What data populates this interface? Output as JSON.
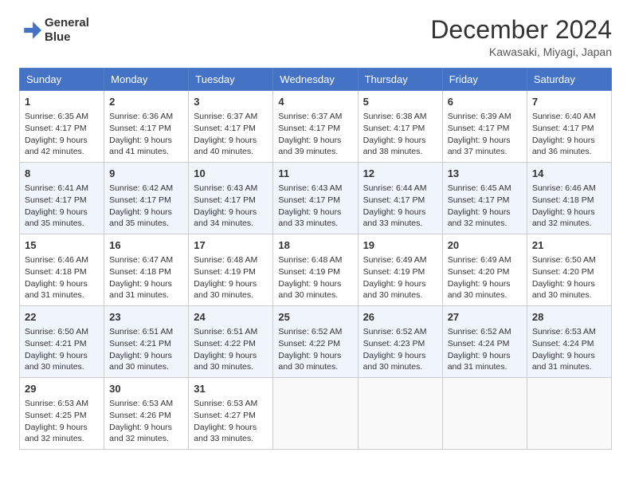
{
  "logo": {
    "line1": "General",
    "line2": "Blue"
  },
  "title": "December 2024",
  "subtitle": "Kawasaki, Miyagi, Japan",
  "headers": [
    "Sunday",
    "Monday",
    "Tuesday",
    "Wednesday",
    "Thursday",
    "Friday",
    "Saturday"
  ],
  "weeks": [
    [
      {
        "day": "1",
        "sunrise": "6:35 AM",
        "sunset": "4:17 PM",
        "daylight": "9 hours and 42 minutes."
      },
      {
        "day": "2",
        "sunrise": "6:36 AM",
        "sunset": "4:17 PM",
        "daylight": "9 hours and 41 minutes."
      },
      {
        "day": "3",
        "sunrise": "6:37 AM",
        "sunset": "4:17 PM",
        "daylight": "9 hours and 40 minutes."
      },
      {
        "day": "4",
        "sunrise": "6:37 AM",
        "sunset": "4:17 PM",
        "daylight": "9 hours and 39 minutes."
      },
      {
        "day": "5",
        "sunrise": "6:38 AM",
        "sunset": "4:17 PM",
        "daylight": "9 hours and 38 minutes."
      },
      {
        "day": "6",
        "sunrise": "6:39 AM",
        "sunset": "4:17 PM",
        "daylight": "9 hours and 37 minutes."
      },
      {
        "day": "7",
        "sunrise": "6:40 AM",
        "sunset": "4:17 PM",
        "daylight": "9 hours and 36 minutes."
      }
    ],
    [
      {
        "day": "8",
        "sunrise": "6:41 AM",
        "sunset": "4:17 PM",
        "daylight": "9 hours and 35 minutes."
      },
      {
        "day": "9",
        "sunrise": "6:42 AM",
        "sunset": "4:17 PM",
        "daylight": "9 hours and 35 minutes."
      },
      {
        "day": "10",
        "sunrise": "6:43 AM",
        "sunset": "4:17 PM",
        "daylight": "9 hours and 34 minutes."
      },
      {
        "day": "11",
        "sunrise": "6:43 AM",
        "sunset": "4:17 PM",
        "daylight": "9 hours and 33 minutes."
      },
      {
        "day": "12",
        "sunrise": "6:44 AM",
        "sunset": "4:17 PM",
        "daylight": "9 hours and 33 minutes."
      },
      {
        "day": "13",
        "sunrise": "6:45 AM",
        "sunset": "4:17 PM",
        "daylight": "9 hours and 32 minutes."
      },
      {
        "day": "14",
        "sunrise": "6:46 AM",
        "sunset": "4:18 PM",
        "daylight": "9 hours and 32 minutes."
      }
    ],
    [
      {
        "day": "15",
        "sunrise": "6:46 AM",
        "sunset": "4:18 PM",
        "daylight": "9 hours and 31 minutes."
      },
      {
        "day": "16",
        "sunrise": "6:47 AM",
        "sunset": "4:18 PM",
        "daylight": "9 hours and 31 minutes."
      },
      {
        "day": "17",
        "sunrise": "6:48 AM",
        "sunset": "4:19 PM",
        "daylight": "9 hours and 30 minutes."
      },
      {
        "day": "18",
        "sunrise": "6:48 AM",
        "sunset": "4:19 PM",
        "daylight": "9 hours and 30 minutes."
      },
      {
        "day": "19",
        "sunrise": "6:49 AM",
        "sunset": "4:19 PM",
        "daylight": "9 hours and 30 minutes."
      },
      {
        "day": "20",
        "sunrise": "6:49 AM",
        "sunset": "4:20 PM",
        "daylight": "9 hours and 30 minutes."
      },
      {
        "day": "21",
        "sunrise": "6:50 AM",
        "sunset": "4:20 PM",
        "daylight": "9 hours and 30 minutes."
      }
    ],
    [
      {
        "day": "22",
        "sunrise": "6:50 AM",
        "sunset": "4:21 PM",
        "daylight": "9 hours and 30 minutes."
      },
      {
        "day": "23",
        "sunrise": "6:51 AM",
        "sunset": "4:21 PM",
        "daylight": "9 hours and 30 minutes."
      },
      {
        "day": "24",
        "sunrise": "6:51 AM",
        "sunset": "4:22 PM",
        "daylight": "9 hours and 30 minutes."
      },
      {
        "day": "25",
        "sunrise": "6:52 AM",
        "sunset": "4:22 PM",
        "daylight": "9 hours and 30 minutes."
      },
      {
        "day": "26",
        "sunrise": "6:52 AM",
        "sunset": "4:23 PM",
        "daylight": "9 hours and 30 minutes."
      },
      {
        "day": "27",
        "sunrise": "6:52 AM",
        "sunset": "4:24 PM",
        "daylight": "9 hours and 31 minutes."
      },
      {
        "day": "28",
        "sunrise": "6:53 AM",
        "sunset": "4:24 PM",
        "daylight": "9 hours and 31 minutes."
      }
    ],
    [
      {
        "day": "29",
        "sunrise": "6:53 AM",
        "sunset": "4:25 PM",
        "daylight": "9 hours and 32 minutes."
      },
      {
        "day": "30",
        "sunrise": "6:53 AM",
        "sunset": "4:26 PM",
        "daylight": "9 hours and 32 minutes."
      },
      {
        "day": "31",
        "sunrise": "6:53 AM",
        "sunset": "4:27 PM",
        "daylight": "9 hours and 33 minutes."
      },
      null,
      null,
      null,
      null
    ]
  ],
  "labels": {
    "sunrise": "Sunrise:",
    "sunset": "Sunset:",
    "daylight": "Daylight:"
  }
}
